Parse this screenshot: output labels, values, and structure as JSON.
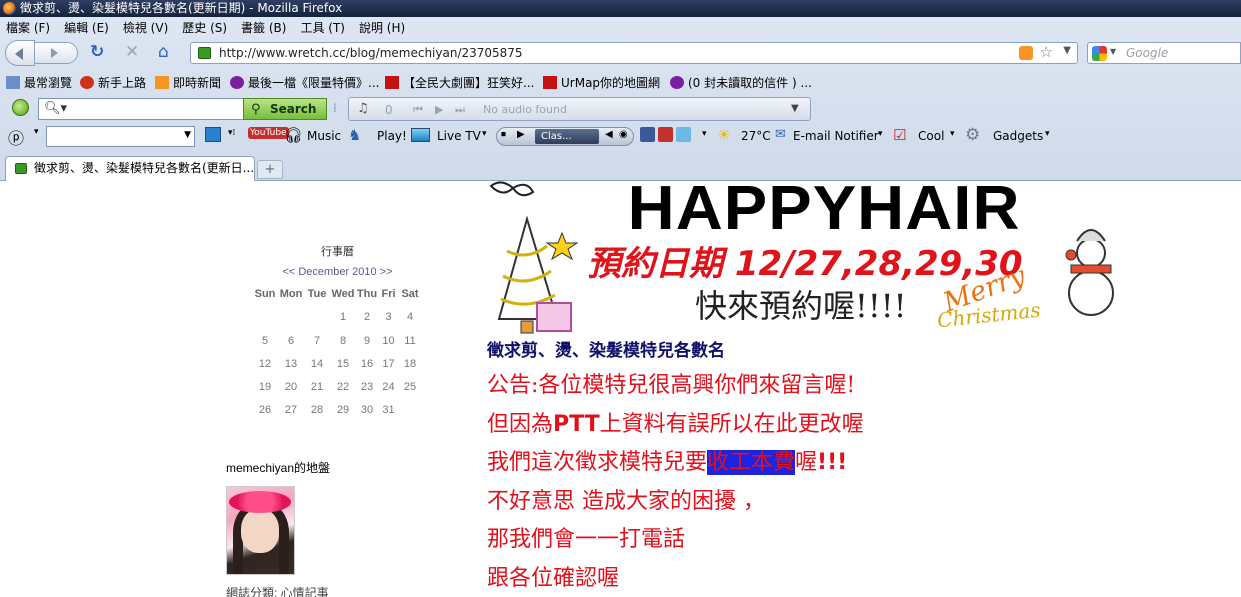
{
  "window": {
    "title": "徵求剪、燙、染髮模特兒各數名(更新日期) - Mozilla Firefox"
  },
  "menu": [
    "檔案 (F)",
    "編輯 (E)",
    "檢視 (V)",
    "歷史 (S)",
    "書籤 (B)",
    "工具 (T)",
    "說明 (H)"
  ],
  "nav": {
    "url": "http://www.wretch.cc/blog/memechiyan/23705875",
    "search_placeholder": "Google"
  },
  "bookmarks": [
    {
      "label": "最常瀏覽",
      "icon": "page-icon"
    },
    {
      "label": "新手上路",
      "icon": "firefox-icon"
    },
    {
      "label": "即時新聞",
      "icon": "rss-icon"
    },
    {
      "label": "最後一檔《限量特價》...",
      "icon": "yahoo-icon"
    },
    {
      "label": "【全民大劇團】狂笑好...",
      "icon": "yahoo-icon"
    },
    {
      "label": "UrMap你的地圖網",
      "icon": "yahoo-icon"
    },
    {
      "label": "(0 封未讀取的信件 ) ...",
      "icon": "yahoo-icon"
    }
  ],
  "toolbar1": {
    "search_button": "Search",
    "audio_count": "0",
    "audio_status": "No audio found"
  },
  "toolbar2": {
    "music": "Music",
    "play": "Play!",
    "livetv": "Live TV",
    "media_preset": "Clas...",
    "weather": "27°C",
    "email": "E-mail Notifier",
    "cool": "Cool",
    "gadgets": "Gadgets",
    "youtube": "YouTube"
  },
  "tab": {
    "label": "徵求剪、燙、染髮模特兒各數名(更新日..."
  },
  "sidebar": {
    "calendar_title": "行事曆",
    "calendar_nav": "<< December 2010 >>",
    "weekdays": [
      "Sun",
      "Mon",
      "Tue",
      "Wed",
      "Thu",
      "Fri",
      "Sat"
    ],
    "days": [
      "",
      "",
      "",
      "1",
      "2",
      "3",
      "4",
      "5",
      "6",
      "7",
      "8",
      "9",
      "10",
      "11",
      "12",
      "13",
      "14",
      "15",
      "16",
      "17",
      "18",
      "19",
      "20",
      "21",
      "22",
      "23",
      "24",
      "25",
      "26",
      "27",
      "28",
      "29",
      "30",
      "31",
      ""
    ],
    "map_title": "memechiyan的地盤",
    "blog_category": "網誌分類: 心情記事"
  },
  "banner": {
    "brand": "HAPPYHAIR",
    "date_line": "預約日期 12/27,28,29,30",
    "cta": "快來預約喔!!!!",
    "merry": "Merry",
    "christmas": "Christmas"
  },
  "post": {
    "title": "徵求剪、燙、染髮模特兒各數名",
    "line1": "公告:各位模特兒很高興你們來留言喔!",
    "line2_a": "但因為",
    "line2_b": "PTT",
    "line2_c": "上資料有誤所以在此更改喔",
    "line3_a": "我們這次徵求模特兒要",
    "line3_hl": "收工本費",
    "line3_b": "喔",
    "line3_c": "!!!",
    "line4": "不好意思 造成大家的困擾 ，",
    "line5": "那我們會一一打電話",
    "line6": "跟各位確認喔"
  }
}
